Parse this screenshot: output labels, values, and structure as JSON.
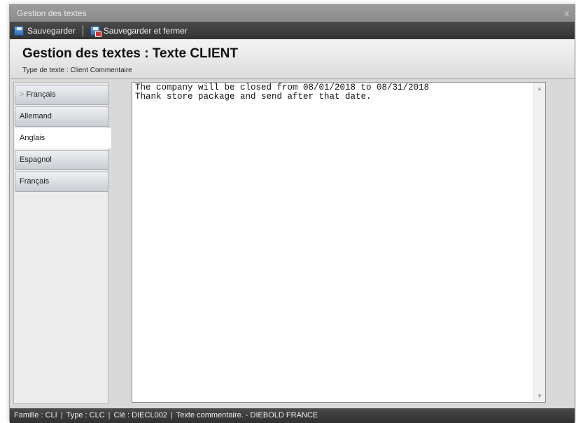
{
  "window": {
    "title": "Gestion des textes",
    "close_glyph": "x"
  },
  "toolbar": {
    "save_label": "Sauvegarder",
    "save_close_label": "Sauvegarder et fermer"
  },
  "header": {
    "title": "Gestion des textes : Texte CLIENT",
    "subtitle": "Type de texte : Client Commentaire"
  },
  "tabs": [
    {
      "label": "Français",
      "active": false,
      "marker": ">"
    },
    {
      "label": "Allemand",
      "active": false
    },
    {
      "label": "Anglais",
      "active": true
    },
    {
      "label": "Espagnol",
      "active": false
    },
    {
      "label": "Français",
      "active": false
    }
  ],
  "editor": {
    "value": "The company will be closed from 08/01/2018 to 08/31/2018\nThank store package and send after that date."
  },
  "statusbar": {
    "famille": "Famille : CLI",
    "type": "Type : CLC",
    "cle": "Clé : DIECL002",
    "description": "Texte commentaire. - DIEBOLD FRANCE",
    "separator": "|"
  }
}
